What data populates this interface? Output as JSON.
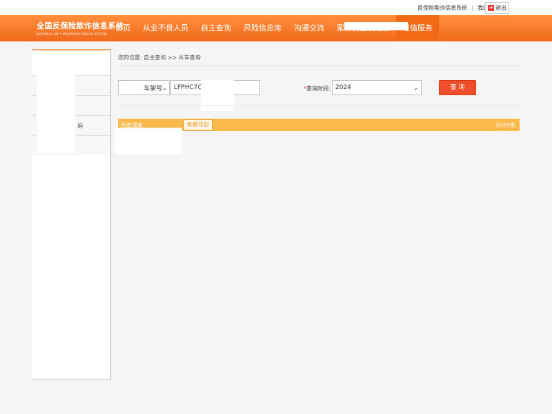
{
  "top": {
    "system_link": "反保险欺诈信息系统",
    "account_link": "我的账号",
    "logout_label": "退出"
  },
  "brand": {
    "name_cn": "全国反保险欺诈信息系统",
    "name_en": "NATIONAL ANTI INSURANCE FRAUD SYSTEM"
  },
  "nav": {
    "items": [
      "首页",
      "从业不良人员",
      "自主查询",
      "风险信息库",
      "沟通交流",
      "案件调查及追偿",
      "增值服务"
    ]
  },
  "sidebar": {
    "items": [
      "",
      "",
      "询",
      ""
    ]
  },
  "breadcrumb": "您的位置: 自主查询 >> 从车查询",
  "form": {
    "field_type": "车架号",
    "vin_value": "LFPHC7CE8R",
    "year_label": "查询时间:",
    "year_value": "2024",
    "query_button": "查 询"
  },
  "results": {
    "title": "历史报案",
    "export_button": "批量导出",
    "total": "共计0条"
  },
  "icons": {
    "dropdown": "chevron-down-icon",
    "logout": "logout-icon"
  },
  "colors": {
    "nav_orange": "#f36a1c",
    "result_bar": "#fbb94b",
    "query_button": "#f04e2a"
  }
}
